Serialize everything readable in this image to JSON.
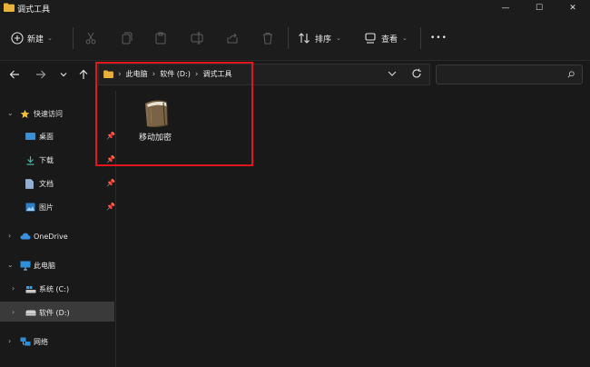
{
  "window": {
    "title": "调式工具",
    "minimize": "—",
    "maximize": "☐",
    "close": "✕"
  },
  "toolbar": {
    "new_label": "新建",
    "sort_label": "排序",
    "view_label": "查看",
    "more_label": "•••"
  },
  "address": {
    "crumbs": [
      "此电脑",
      "软件 (D:)",
      "调式工具"
    ]
  },
  "sidebar": {
    "quick_access": "快速访问",
    "items": [
      {
        "label": "桌面"
      },
      {
        "label": "下载"
      },
      {
        "label": "文档"
      },
      {
        "label": "图片"
      }
    ],
    "onedrive": "OneDrive",
    "this_pc": "此电脑",
    "drives": [
      {
        "label": "系统 (C:)"
      },
      {
        "label": "软件 (D:)"
      }
    ],
    "network": "网络"
  },
  "content": {
    "files": [
      {
        "name": "移动加密"
      }
    ]
  },
  "colors": {
    "highlight_border": "#e0151d",
    "folder_yellow": "#e8b23a",
    "accent_blue": "#4a9fe3"
  }
}
